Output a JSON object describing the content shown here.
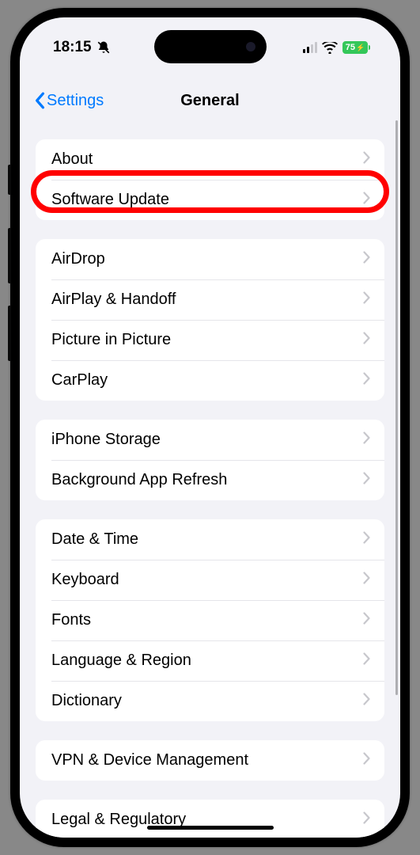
{
  "status": {
    "time": "18:15",
    "battery_text": "75"
  },
  "nav": {
    "back_label": "Settings",
    "title": "General"
  },
  "groups": [
    {
      "rows": [
        {
          "label": "About",
          "name": "about"
        },
        {
          "label": "Software Update",
          "name": "software-update",
          "highlighted": true
        }
      ]
    },
    {
      "rows": [
        {
          "label": "AirDrop",
          "name": "airdrop"
        },
        {
          "label": "AirPlay & Handoff",
          "name": "airplay-handoff"
        },
        {
          "label": "Picture in Picture",
          "name": "picture-in-picture"
        },
        {
          "label": "CarPlay",
          "name": "carplay"
        }
      ]
    },
    {
      "rows": [
        {
          "label": "iPhone Storage",
          "name": "iphone-storage"
        },
        {
          "label": "Background App Refresh",
          "name": "background-app-refresh"
        }
      ]
    },
    {
      "rows": [
        {
          "label": "Date & Time",
          "name": "date-time"
        },
        {
          "label": "Keyboard",
          "name": "keyboard"
        },
        {
          "label": "Fonts",
          "name": "fonts"
        },
        {
          "label": "Language & Region",
          "name": "language-region"
        },
        {
          "label": "Dictionary",
          "name": "dictionary"
        }
      ]
    },
    {
      "rows": [
        {
          "label": "VPN & Device Management",
          "name": "vpn-device-management"
        }
      ]
    },
    {
      "rows": [
        {
          "label": "Legal & Regulatory",
          "name": "legal-regulatory"
        }
      ]
    }
  ]
}
